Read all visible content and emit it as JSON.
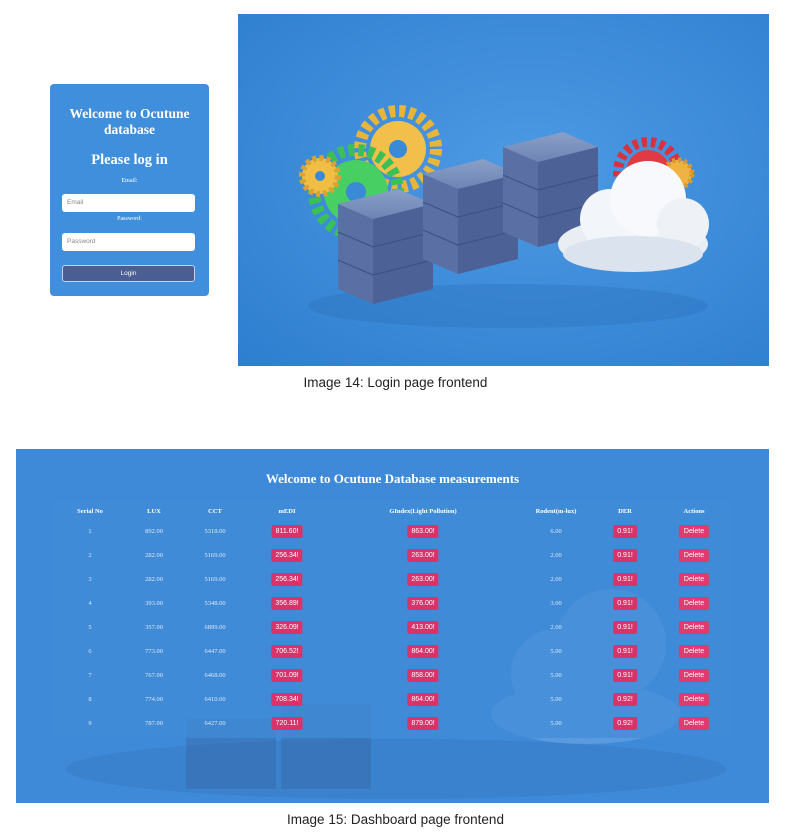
{
  "login": {
    "title": "Welcome to Ocutune database",
    "subtitle": "Please log in",
    "email_label": "Email:",
    "email_placeholder": "Email",
    "password_label": "Password:",
    "password_placeholder": "Password",
    "login_button": "Login"
  },
  "captions": {
    "image14": "Image 14: Login page frontend",
    "image15": "Image 15: Dashboard page frontend"
  },
  "dashboard": {
    "title": "Welcome to Ocutune Database measurements",
    "columns": [
      "Serial No",
      "LUX",
      "CCT",
      "mEDI",
      "GIndex(Light Pollution)",
      "Rodent(m-lux)",
      "DER",
      "Actions"
    ],
    "rows": [
      {
        "serial": "1",
        "lux": "892.00",
        "cct": "5318.00",
        "medi": "811.60!",
        "gindex": "863.00!",
        "rodent": "6.00",
        "der": "0.91!",
        "action": "Delete"
      },
      {
        "serial": "2",
        "lux": "282.00",
        "cct": "5169.00",
        "medi": "256.34!",
        "gindex": "263.00!",
        "rodent": "2.00",
        "der": "0.91!",
        "action": "Delete"
      },
      {
        "serial": "3",
        "lux": "282.00",
        "cct": "5169.00",
        "medi": "256.34!",
        "gindex": "263.00!",
        "rodent": "2.00",
        "der": "0.91!",
        "action": "Delete"
      },
      {
        "serial": "4",
        "lux": "393.00",
        "cct": "5348.00",
        "medi": "356.89!",
        "gindex": "376.00!",
        "rodent": "3.00",
        "der": "0.91!",
        "action": "Delete"
      },
      {
        "serial": "5",
        "lux": "357.00",
        "cct": "6899.00",
        "medi": "326.09!",
        "gindex": "413.00!",
        "rodent": "2.00",
        "der": "0.91!",
        "action": "Delete"
      },
      {
        "serial": "6",
        "lux": "773.00",
        "cct": "6447.00",
        "medi": "706.52!",
        "gindex": "864.00!",
        "rodent": "5.00",
        "der": "0.91!",
        "action": "Delete"
      },
      {
        "serial": "7",
        "lux": "767.00",
        "cct": "6468.00",
        "medi": "701.09!",
        "gindex": "858.00!",
        "rodent": "5.00",
        "der": "0.91!",
        "action": "Delete"
      },
      {
        "serial": "8",
        "lux": "774.00",
        "cct": "6410.00",
        "medi": "708.34!",
        "gindex": "864.00!",
        "rodent": "5.00",
        "der": "0.92!",
        "action": "Delete"
      },
      {
        "serial": "9",
        "lux": "787.00",
        "cct": "6427.00",
        "medi": "720.11!",
        "gindex": "879.00!",
        "rodent": "5.00",
        "der": "0.92!",
        "action": "Delete"
      }
    ]
  },
  "colors": {
    "card_blue": "#3f8fdc",
    "login_button": "#4a5e93",
    "badge_pink": "#d8336b",
    "delete_pink": "#e03a6e",
    "hero_blue": "#3a8ad8"
  }
}
